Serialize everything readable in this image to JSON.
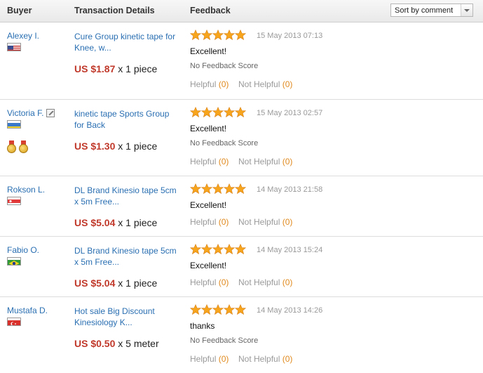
{
  "header": {
    "buyer": "Buyer",
    "details": "Transaction Details",
    "feedback": "Feedback",
    "sort_label": "Sort by comment"
  },
  "colors": {
    "link": "#2a6fb2",
    "price": "#c0392b",
    "count": "#e08a1e",
    "star": "#f7a51c"
  },
  "reviews": [
    {
      "buyer": "Alexey I.",
      "flag": "us-flag-icon",
      "product": "Cure Group kinetic tape for Knee, w...",
      "price": "US $1.87",
      "qty": "x 1 piece",
      "stars": 5,
      "date": "15 May 2013 07:13",
      "comment": "Excellent!",
      "score": "No Feedback Score",
      "helpful_label": "Helpful",
      "helpful_count": "(0)",
      "not_helpful_label": "Not Helpful",
      "not_helpful_count": "(0)"
    },
    {
      "buyer": "Victoria F.",
      "flag": "ukraine-flag-icon",
      "product": "kinetic tape Sports Group for Back",
      "price": "US $1.30",
      "qty": "x 1 piece",
      "stars": 5,
      "date": "15 May 2013 02:57",
      "comment": "Excellent!",
      "score": "No Feedback Score",
      "helpful_label": "Helpful",
      "helpful_count": "(0)",
      "not_helpful_label": "Not Helpful",
      "not_helpful_count": "(0)"
    },
    {
      "buyer": "Rokson L.",
      "flag": "singapore-flag-icon",
      "product": "DL Brand Kinesio tape 5cm x 5m Free...",
      "price": "US $5.04",
      "qty": "x 1 piece",
      "stars": 5,
      "date": "14 May 2013 21:58",
      "comment": "Excellent!",
      "score": "",
      "helpful_label": "Helpful",
      "helpful_count": "(0)",
      "not_helpful_label": "Not Helpful",
      "not_helpful_count": "(0)"
    },
    {
      "buyer": "Fabio O.",
      "flag": "brazil-flag-icon",
      "product": "DL Brand Kinesio tape 5cm x 5m Free...",
      "price": "US $5.04",
      "qty": "x 1 piece",
      "stars": 5,
      "date": "14 May 2013 15:24",
      "comment": "Excellent!",
      "score": "",
      "helpful_label": "Helpful",
      "helpful_count": "(0)",
      "not_helpful_label": "Not Helpful",
      "not_helpful_count": "(0)"
    },
    {
      "buyer": "Mustafa D.",
      "flag": "turkey-flag-icon",
      "product": "Hot sale Big Discount Kinesiology K...",
      "price": "US $0.50",
      "qty": "x 5 meter",
      "stars": 5,
      "date": "14 May 2013 14:26",
      "comment": "thanks",
      "score": "No Feedback Score",
      "helpful_label": "Helpful",
      "helpful_count": "(0)",
      "not_helpful_label": "Not Helpful",
      "not_helpful_count": "(0)"
    }
  ]
}
